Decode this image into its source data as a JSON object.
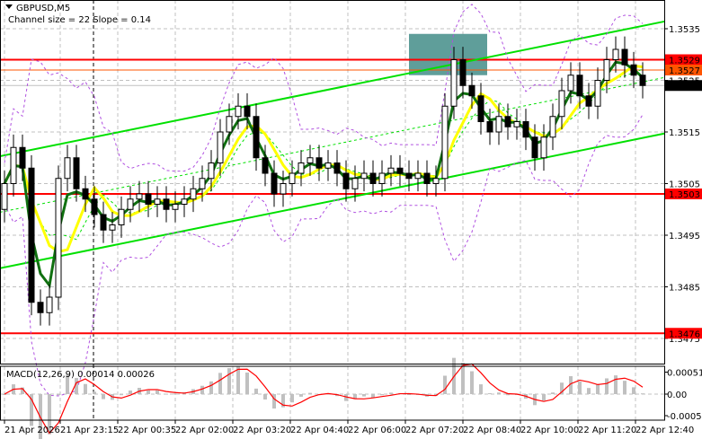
{
  "window": {
    "symbol_title": "GBPUSD,M5",
    "indicator_note": "Channel size = 22 Slope = 0.14"
  },
  "macd": {
    "label": "MACD(12,26,9) 0.00014 0.00026",
    "axis_labels": [
      "0.00051",
      "0.00",
      "-0.0005"
    ],
    "axis_values": [
      0.00051,
      0,
      -0.0005
    ]
  },
  "colors": {
    "up_channel": "#00e000",
    "ma_fast": "#107010",
    "ma_slow": "#ffff00",
    "bands": "#b050e0",
    "level": "#ff0000",
    "entry": "#ff5500",
    "zone": "#5f9e9a",
    "macd_hist": "#c0c0c0",
    "macd_signal": "#ff0000"
  },
  "chart_data": {
    "type": "candlestick",
    "title": "GBPUSD,M5",
    "ylim": [
      1.3471,
      1.3541
    ],
    "y_ticks": [
      "1.3535",
      "1.3525",
      "1.3515",
      "1.3505",
      "1.3495",
      "1.3485",
      "1.3475"
    ],
    "y_tick_values": [
      1.3535,
      1.3525,
      1.3515,
      1.3505,
      1.3495,
      1.3485,
      1.3475
    ],
    "x_ticks": [
      "21 Apr 2026",
      "21 Apr 23:15",
      "22 Apr 00:35",
      "22 Apr 02:00",
      "22 Apr 03:20",
      "22 Apr 04:40",
      "22 Apr 06:00",
      "22 Apr 07:20",
      "22 Apr 08:40",
      "22 Apr 10:00",
      "22 Apr 11:20",
      "22 Apr 12:40"
    ],
    "x_tick_bars": [
      0,
      6.2,
      12.6,
      19,
      25.4,
      31.8,
      38.2,
      44.6,
      51,
      57.4,
      63.8,
      70.2
    ],
    "close": [
      1.3505,
      1.3512,
      1.3508,
      1.3482,
      1.348,
      1.3483,
      1.3506,
      1.351,
      1.3504,
      1.3502,
      1.3499,
      1.3496,
      1.3497,
      1.35,
      1.3502,
      1.3503,
      1.3501,
      1.3502,
      1.35,
      1.3501,
      1.3502,
      1.3504,
      1.3506,
      1.3509,
      1.3515,
      1.3518,
      1.352,
      1.3518,
      1.351,
      1.3507,
      1.3503,
      1.3505,
      1.3507,
      1.3509,
      1.351,
      1.3508,
      1.3509,
      1.3507,
      1.3504,
      1.3506,
      1.3507,
      1.3505,
      1.3507,
      1.3508,
      1.3507,
      1.3506,
      1.3507,
      1.3505,
      1.3506,
      1.352,
      1.3529,
      1.3524,
      1.3522,
      1.3517,
      1.3515,
      1.3518,
      1.3516,
      1.3517,
      1.3514,
      1.351,
      1.3514,
      1.3518,
      1.3523,
      1.3526,
      1.3522,
      1.352,
      1.3525,
      1.3529,
      1.3531,
      1.3528,
      1.3526,
      1.3524
    ],
    "first_open": 1.35,
    "levels": [
      {
        "price": 1.3529,
        "label": "1.3529",
        "kind": "level"
      },
      {
        "price": 1.3527,
        "label": "1.3527",
        "kind": "entry"
      },
      {
        "price": 1.3503,
        "label": "1.3503",
        "kind": "level"
      },
      {
        "price": 1.3476,
        "label": "1.3476",
        "kind": "level"
      }
    ],
    "current_price": {
      "price": 1.3524,
      "label": "1.3524"
    },
    "channel": {
      "start_bar": -0.5,
      "end_bar": 73.4,
      "upper": [
        1.35103,
        1.35364
      ],
      "lower": [
        1.34886,
        1.35147
      ]
    },
    "zone": {
      "from_bar": 45,
      "to_bar": 53.7,
      "top": 1.3534,
      "bottom": 1.3526
    },
    "period_separator_bar": 9.9
  }
}
